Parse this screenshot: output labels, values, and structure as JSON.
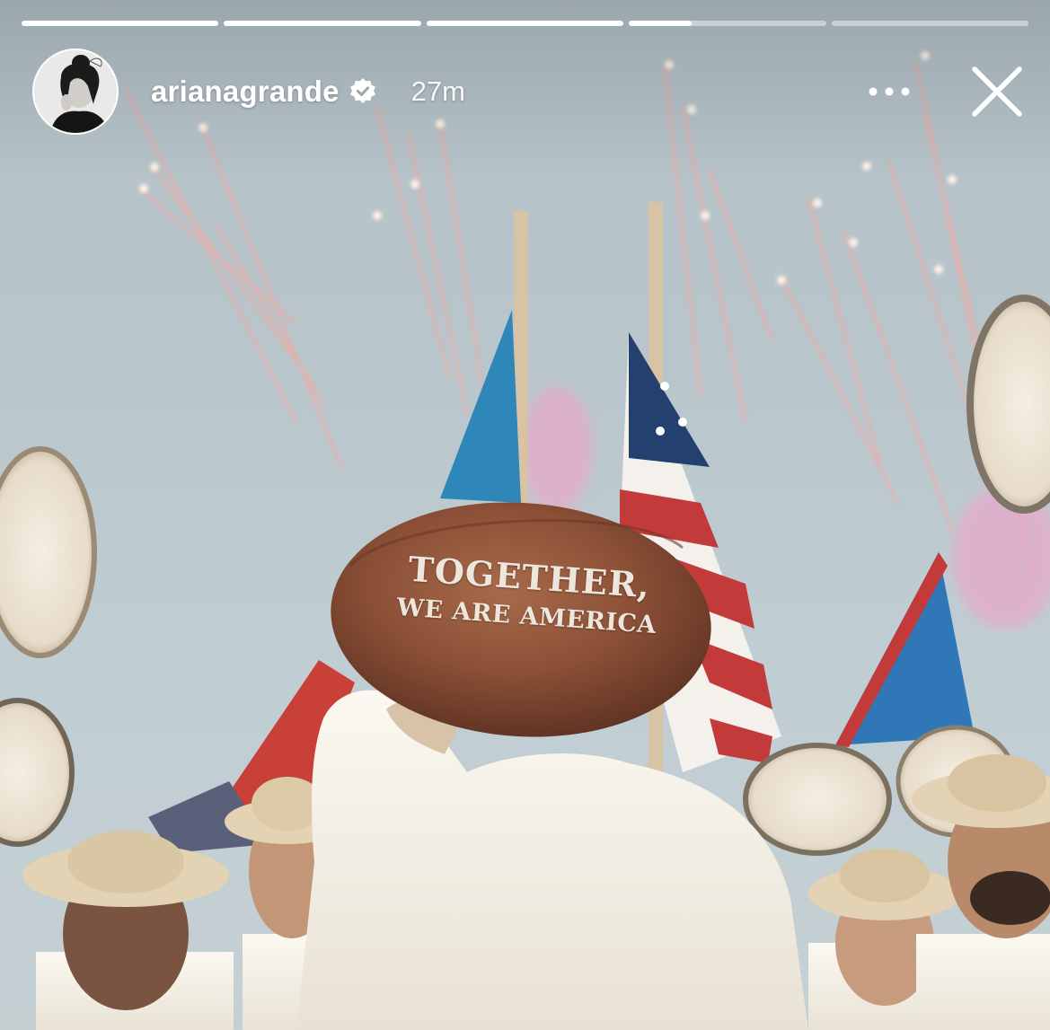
{
  "story": {
    "progress": [
      1,
      1,
      1,
      0.32,
      0
    ],
    "username": "arianagrande",
    "verified": true,
    "timestamp": "27m",
    "football_text": {
      "line1": "TOGETHER,",
      "line2": "WE ARE AMERICA"
    }
  },
  "icons": {
    "verified": "verified-badge-icon",
    "more": "more-options-icon",
    "close": "close-icon"
  },
  "colors": {
    "sky": "#b8c6cc",
    "football": "#8a4f36",
    "flag_red": "#c23a3a",
    "flag_blue": "#2f77b7",
    "shirts": "#f3efe6"
  }
}
